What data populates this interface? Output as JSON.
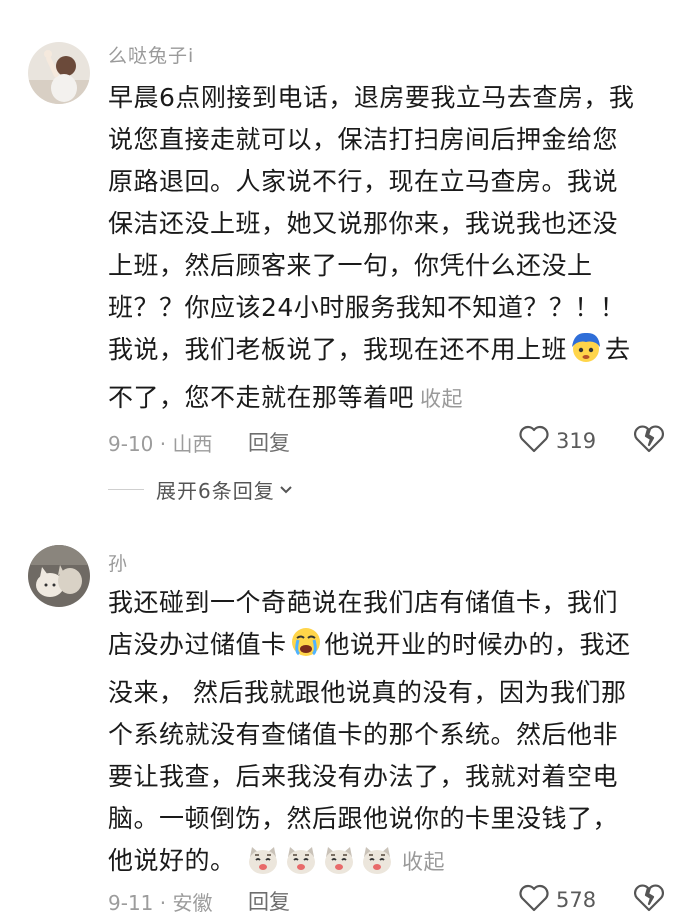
{
  "comments": [
    {
      "username": "么哒兔子i",
      "lines": [
        "早晨6点刚接到电话，退房要我立马去查房，我",
        "说您直接走就可以，保洁打扫房间后押金给您",
        "原路退回。人家说不行，现在立马查房。我说",
        "保洁还没上班，她又说那你来，我说我也还没",
        "上班，然后顾客来了一句，你凭什么还没上",
        "班？？你应该24小时服务我知不知道？？！！",
        "我说，我们老板说了，我现在还不用上班",
        "去",
        "不了，您不走就在那等着吧"
      ],
      "collapse": "收起",
      "date_location": "9-10 · 山西",
      "reply": "回复",
      "likes": "319",
      "expand_replies": "展开6条回复",
      "emoji": "blue-hair-face-emoji"
    },
    {
      "username": "孙",
      "lines": [
        "我还碰到一个奇葩说在我们店有储值卡，我们",
        "店没办过储值卡",
        "他说开业的时候办的，我还",
        "没来， 然后我就跟他说真的没有，因为我们那",
        "个系统就没有查储值卡的那个系统。然后他非",
        "要让我查，后来我没有办法了，我就对着空电",
        "脑。一顿倒饬，然后跟他说你的卡里没钱了，",
        "他说好的。"
      ],
      "collapse": "收起",
      "date_location": "9-11 · 安徽",
      "reply": "回复",
      "likes": "578",
      "emoji": "crying-face-emoji",
      "trailing_emoji": "cat-face-emoji"
    }
  ],
  "colors": {
    "text": "#1a1a1a",
    "muted": "#9a9a9a",
    "white": "#ffffff"
  }
}
